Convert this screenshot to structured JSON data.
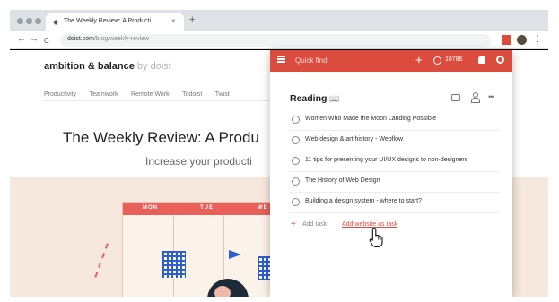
{
  "browser": {
    "tab_favicon": "doist-logo",
    "tab_title": "The Weekly Review: A Producti",
    "tab_close": "×",
    "new_tab": "+",
    "back": "←",
    "forward": "→",
    "reload": "C",
    "url_domain": "doist.com",
    "url_path": "/blog/weekly-review",
    "menu": "⋮"
  },
  "site": {
    "brand": "ambition & balance",
    "brand_by": "by doist",
    "nav": [
      "Productivity",
      "Teamwork",
      "Remote Work",
      "Todoist",
      "Twist"
    ],
    "headline": "The Weekly Review: A Produ",
    "subhead": "Increase your producti",
    "hero_days": [
      "MON",
      "TUE",
      "WE"
    ]
  },
  "popup": {
    "search_placeholder": "Quick find",
    "karma_points": "10786",
    "project": {
      "name": "Reading",
      "emoji": "📖"
    },
    "tasks": [
      "Women Who Made the Moon Landing Possible",
      "Web design & art history - Webflow",
      "11 tips for presenting your UI/UX designs to non-designers",
      "The History of Web Design",
      "Building a design system - where to start?"
    ],
    "add_task_label": "Add task",
    "add_website_label": "Add website as task"
  },
  "icons": {
    "menu": "hamburger-icon",
    "add": "plus-icon",
    "karma": "karma-icon",
    "notifications": "bell-icon",
    "settings": "gear-icon",
    "comments": "comment-icon",
    "share": "person-icon",
    "more": "more-icon",
    "cursor": "hand-pointer-icon"
  },
  "colors": {
    "accent": "#db4c3f",
    "hero_bg": "#f6e8dc",
    "illustration_blue": "#2e5cd1"
  }
}
